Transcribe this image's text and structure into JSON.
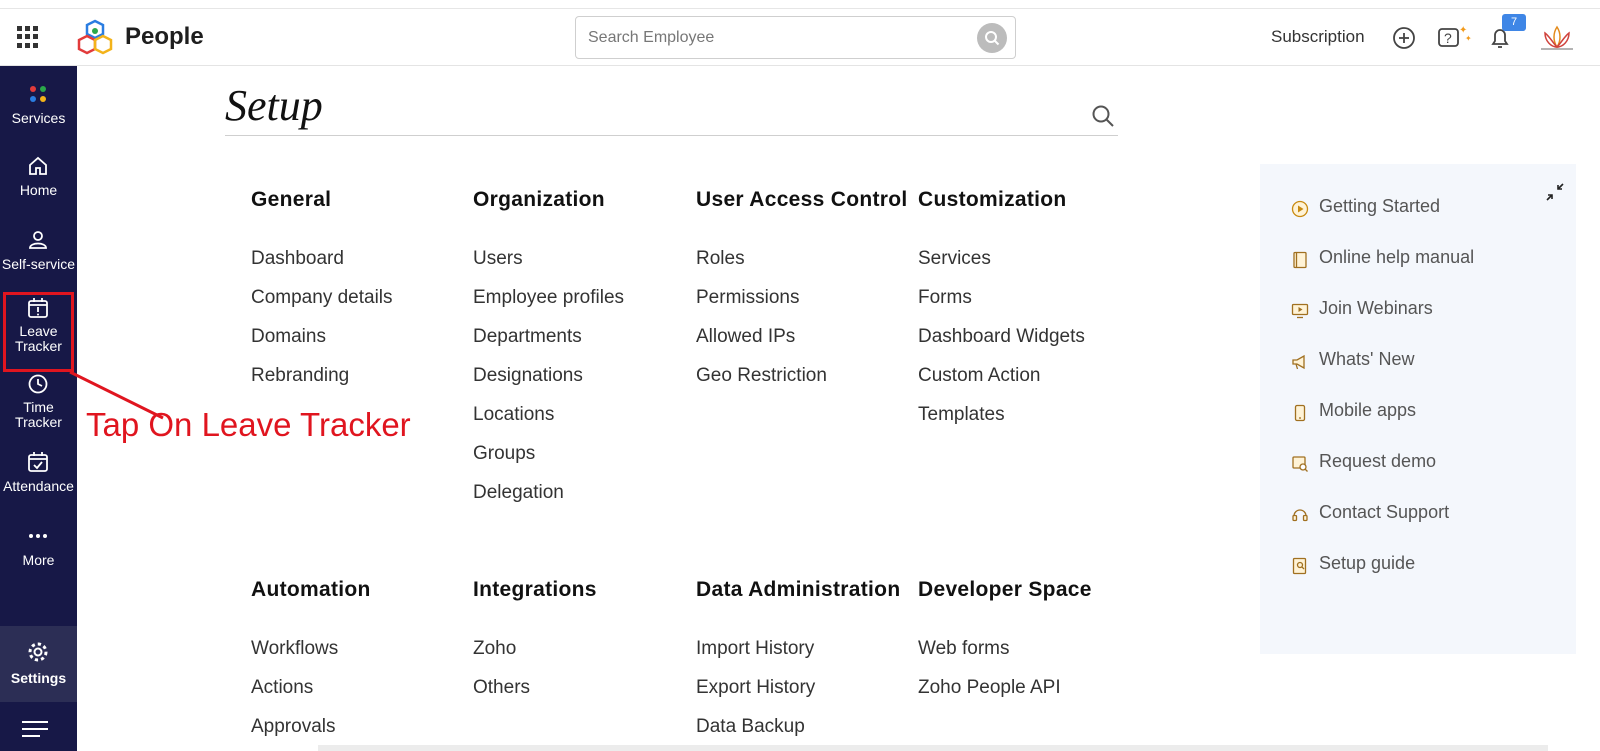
{
  "header": {
    "app_name": "People",
    "search_placeholder": "Search Employee",
    "subscription": "Subscription",
    "notification_count": "7"
  },
  "sidebar": {
    "items": [
      {
        "label": "Services",
        "icon": "services-dots-icon"
      },
      {
        "label": "Home",
        "icon": "home-icon"
      },
      {
        "label": "Self-service",
        "icon": "person-icon"
      },
      {
        "label_line1": "Leave",
        "label_line2": "Tracker",
        "icon": "calendar-alert-icon"
      },
      {
        "label_line1": "Time",
        "label_line2": "Tracker",
        "icon": "clock-icon"
      },
      {
        "label": "Attendance",
        "icon": "calendar-check-icon"
      },
      {
        "label": "More",
        "icon": "more-dots-icon"
      }
    ],
    "settings_label": "Settings"
  },
  "annotation": {
    "text": "Tap On Leave Tracker",
    "color": "#e0151f"
  },
  "setup": {
    "title": "Setup",
    "sections": [
      {
        "heading": "General",
        "links": [
          "Dashboard",
          "Company details",
          "Domains",
          "Rebranding"
        ]
      },
      {
        "heading": "Organization",
        "links": [
          "Users",
          "Employee profiles",
          "Departments",
          "Designations",
          "Locations",
          "Groups",
          "Delegation"
        ]
      },
      {
        "heading": "User Access Control",
        "links": [
          "Roles",
          "Permissions",
          "Allowed IPs",
          "Geo Restriction"
        ]
      },
      {
        "heading": "Customization",
        "links": [
          "Services",
          "Forms",
          "Dashboard Widgets",
          "Custom Action",
          "Templates"
        ]
      },
      {
        "heading": "Automation",
        "links": [
          "Workflows",
          "Actions",
          "Approvals"
        ]
      },
      {
        "heading": "Integrations",
        "links": [
          "Zoho",
          "Others"
        ]
      },
      {
        "heading": "Data Administration",
        "links": [
          "Import History",
          "Export History",
          "Data Backup"
        ]
      },
      {
        "heading": "Developer Space",
        "links": [
          "Web forms",
          "Zoho People API"
        ]
      }
    ]
  },
  "help": {
    "items": [
      {
        "label": "Getting Started",
        "icon": "play-circle-icon"
      },
      {
        "label": "Online help manual",
        "icon": "book-icon"
      },
      {
        "label": "Join Webinars",
        "icon": "webinar-icon"
      },
      {
        "label": "Whats' New",
        "icon": "megaphone-icon"
      },
      {
        "label": "Mobile apps",
        "icon": "mobile-icon"
      },
      {
        "label": "Request demo",
        "icon": "demo-icon"
      },
      {
        "label": "Contact Support",
        "icon": "headset-icon"
      },
      {
        "label": "Setup guide",
        "icon": "guide-icon"
      }
    ]
  },
  "colors": {
    "sidebar_bg": "#171847",
    "accent_red": "#e0151f",
    "badge_blue": "#3f86e6",
    "help_bg": "#f4f7fc"
  }
}
